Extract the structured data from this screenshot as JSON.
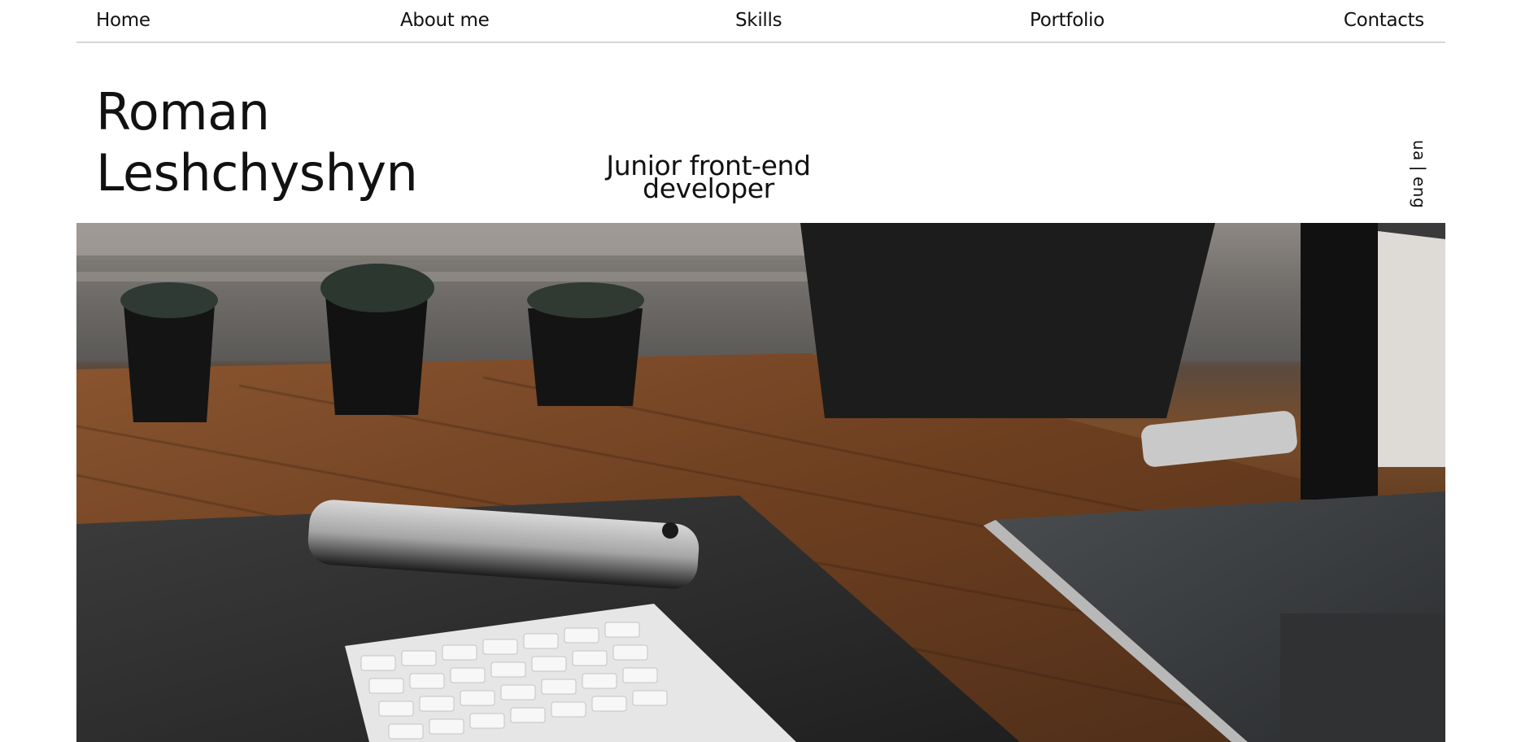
{
  "nav": {
    "items": [
      {
        "label": "Home",
        "id": "home"
      },
      {
        "label": "About me",
        "id": "about"
      },
      {
        "label": "Skills",
        "id": "skills"
      },
      {
        "label": "Portfolio",
        "id": "portfolio"
      },
      {
        "label": "Contacts",
        "id": "contacts"
      }
    ]
  },
  "hero": {
    "name_line1": "Roman",
    "name_line2": "Leshchyshyn",
    "role_line1": "Junior front-end",
    "role_line2": "developer"
  },
  "language": {
    "ua": "ua",
    "separator": "|",
    "eng": "eng"
  },
  "photo": {
    "description_icon": "desk-workspace-photo"
  }
}
